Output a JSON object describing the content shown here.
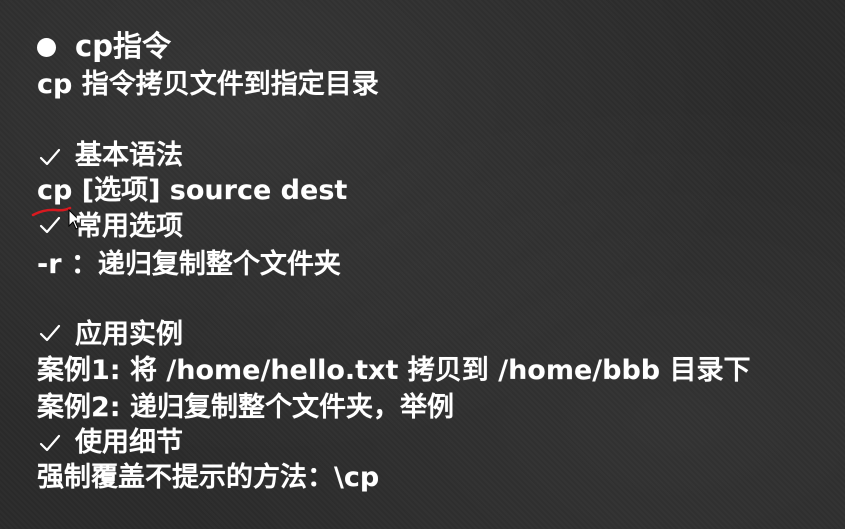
{
  "slide": {
    "title": "cp指令",
    "description": "cp 指令拷贝文件到指定目录",
    "sections": {
      "syntax_heading": "基本语法",
      "syntax": "cp [选项] source dest",
      "options_heading": "常用选项",
      "option_r": "-r ：递归复制整个文件夹",
      "examples_heading": "应用实例",
      "example1": "案例1: 将 /home/hello.txt 拷贝到  /home/bbb 目录下",
      "example2": "案例2: 递归复制整个文件夹，举例",
      "details_heading": "使用细节",
      "detail1": "强制覆盖不提示的方法：\\cp"
    },
    "icons": {
      "bullet": "bullet-dot-icon",
      "check": "check-mark-icon",
      "cursor": "mouse-cursor-icon"
    },
    "colors": {
      "background": "#2b2b2b",
      "text": "#ffffff",
      "annotation": "#d9191f"
    }
  }
}
